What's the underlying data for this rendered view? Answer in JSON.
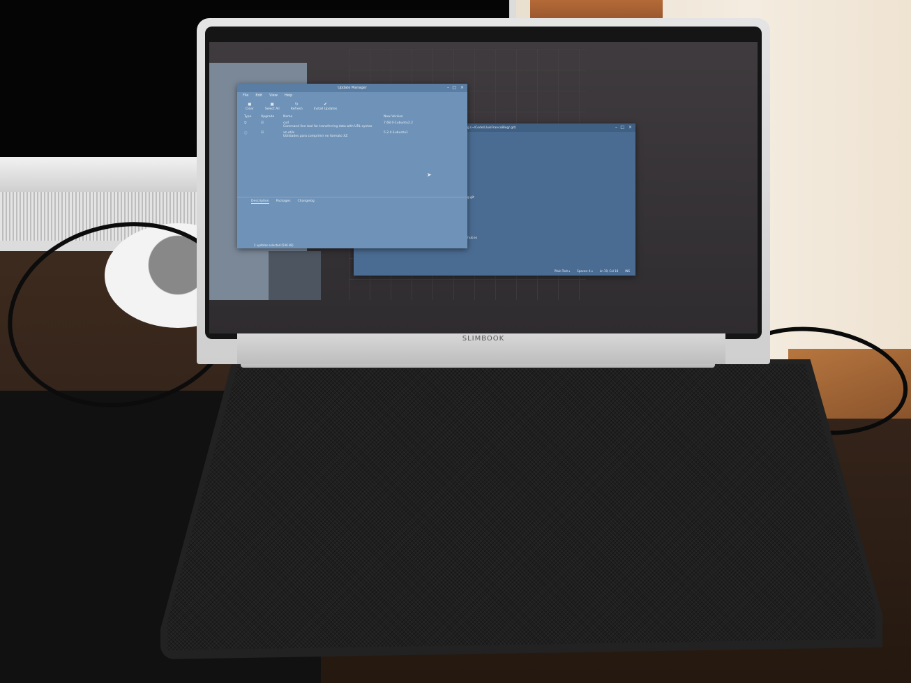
{
  "update_manager": {
    "title": "Update Manager",
    "menu": [
      "File",
      "Edit",
      "View",
      "Help"
    ],
    "toolbar": [
      "Clear",
      "Select All",
      "Refresh",
      "Install Updates"
    ],
    "columns": [
      "Type",
      "Upgrade",
      "Name",
      "New Version"
    ],
    "rows": [
      {
        "name": "curl",
        "description": "Command line tool for transferring data with URL syntax",
        "version": "7.68.0-1ubuntu2.2"
      },
      {
        "name": "xz-utils",
        "description": "Utilidades para comprimir en formato XZ",
        "version": "5.2.4-1ubuntu1"
      }
    ],
    "tabs": [
      "Description",
      "Packages",
      "Changelog"
    ],
    "status": "2 updates selected (546 kB)"
  },
  "editor": {
    "title": "fig (~/Code/LluisFrancoBlog/.git)",
    "snippet_1": "og.git",
    "snippet_2": "ithub.io",
    "status": [
      "Plain Text ▾",
      "Spaces: 4 ▾",
      "Ln 19, Col 18",
      "INS"
    ]
  },
  "laptop": {
    "brand": "SLIMBOOK"
  },
  "colors": {
    "window": "#6f93b8",
    "titlebar": "#5a7ea3",
    "screen": "#3a373a"
  }
}
